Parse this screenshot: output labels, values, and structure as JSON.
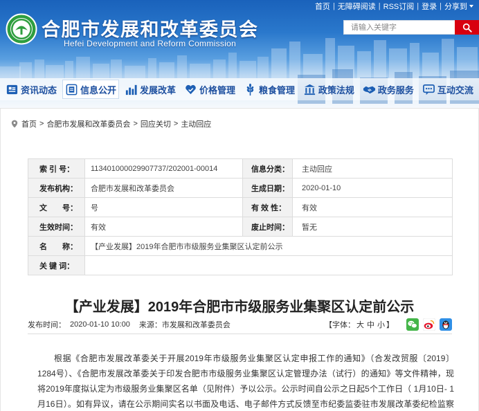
{
  "top_links": {
    "separator": "|",
    "items": [
      "首页",
      "无障碍阅读",
      "RSS订阅",
      "登录",
      "分享到"
    ],
    "share_dropdown_icon": "chevron-down-icon"
  },
  "site": {
    "title": "合肥市发展和改革委员会",
    "subtitle": "Hefei Development and Reform Commission",
    "logo_icon": "site-emblem-icon"
  },
  "search": {
    "placeholder": "请输入关键字",
    "button_icon": "search-icon"
  },
  "nav": {
    "items": [
      {
        "label": "资讯动态",
        "icon": "news-icon"
      },
      {
        "label": "信息公开",
        "icon": "document-icon",
        "active": true
      },
      {
        "label": "发展改革",
        "icon": "bar-chart-icon"
      },
      {
        "label": "价格管理",
        "icon": "price-heart-icon"
      },
      {
        "label": "粮食管理",
        "icon": "wheat-icon"
      },
      {
        "label": "政策法规",
        "icon": "courthouse-icon"
      },
      {
        "label": "政务服务",
        "icon": "handshake-icon"
      },
      {
        "label": "互动交流",
        "icon": "chat-icon"
      }
    ]
  },
  "breadcrumb": {
    "icon": "location-pin-icon",
    "separator": ">",
    "items": [
      "首页",
      "合肥市发展和改革委员会",
      "回应关切",
      "主动回应"
    ]
  },
  "info_table": {
    "rows": [
      {
        "label1": "索 引 号：",
        "value1": "113401000029907737/202001-00014",
        "label2": "信息分类：",
        "value2": "主动回应"
      },
      {
        "label1": "发布机构：",
        "value1": "合肥市发展和改革委员会",
        "label2": "生成日期：",
        "value2": "2020-01-10"
      },
      {
        "label1": "文　　号：",
        "value1": "号",
        "label2": "有 效 性：",
        "value2": "有效"
      },
      {
        "label1": "生效时间：",
        "value1": "有效",
        "label2": "废止时间：",
        "value2": "暂无"
      }
    ],
    "name": {
      "label": "名　　称：",
      "value": "【产业发展】2019年合肥市市级服务业集聚区认定前公示"
    },
    "keywords": {
      "label": "关 键 词：",
      "value": ""
    }
  },
  "article": {
    "title": "【产业发展】2019年合肥市市级服务业集聚区认定前公示",
    "publish_label": "发布时间：",
    "publish_time": "2020-01-10 10:00",
    "source_label": "来源：",
    "source": "市发展和改革委员会",
    "font_size": {
      "prefix": "【字体：",
      "options": [
        "大",
        "中",
        "小"
      ],
      "suffix": "】"
    },
    "share_icons": [
      "wechat-icon",
      "weibo-icon",
      "qq-icon"
    ],
    "body": "根据《合肥市发展改革委关于开展2019年市级服务业集聚区认定申报工作的通知》（合发改贸服〔2019〕1284号）、《合肥市发展改革委关于印发合肥市市级服务业集聚区认定管理办法（试行）的通知》等文件精神，现将2019年度拟认定为市级服务业集聚区名单（见附件）予以公示。公示时间自公示之日起5个工作日（ 1月10日- 1月16日）。如有异议，请在公示期间实名以书面及电话、电子邮件方式反馈至市纪委监委驻市发展改革委纪检监察组。"
  },
  "colors": {
    "header_blue": "#1a62bb",
    "nav_text": "#1d4f9f",
    "search_button": "#d8000f",
    "logo_green": "#2f9e3f",
    "label_background": "#f2f2f2",
    "table_border": "#dcdcdc"
  }
}
